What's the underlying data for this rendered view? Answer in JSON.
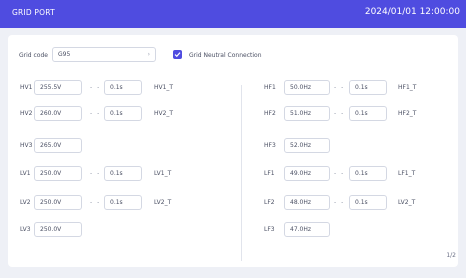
{
  "header": {
    "title": "GRID PORT",
    "datetime": "2024/01/01 12:00:00"
  },
  "grid_code": {
    "label": "Grid code",
    "value": "G95"
  },
  "neutral": {
    "label": "Grid Neutral Connection",
    "checked": true
  },
  "dash": "- -",
  "left_rows": [
    {
      "label": "HV1",
      "value": "255.5V",
      "time": "0.1s",
      "tag": "HV1_T"
    },
    {
      "label": "HV2",
      "value": "260.0V",
      "time": "0.1s",
      "tag": "HV2_T"
    },
    {
      "label": "HV3",
      "value": "265.0V"
    },
    {
      "label": "LV1",
      "value": "250.0V",
      "time": "0.1s",
      "tag": "LV1_T"
    },
    {
      "label": "LV2",
      "value": "250.0V",
      "time": "0.1s",
      "tag": "LV2_T"
    },
    {
      "label": "LV3",
      "value": "250.0V"
    }
  ],
  "right_rows": [
    {
      "label": "HF1",
      "value": "50.0Hz",
      "time": "0.1s",
      "tag": "HF1_T"
    },
    {
      "label": "HF2",
      "value": "51.0Hz",
      "time": "0.1s",
      "tag": "HF2_T"
    },
    {
      "label": "HF3",
      "value": "52.0Hz"
    },
    {
      "label": "LF1",
      "value": "49.0Hz",
      "time": "0.1s",
      "tag": "LF1_T"
    },
    {
      "label": "LF2",
      "value": "48.0Hz",
      "time": "0.1s",
      "tag": "LV2_T"
    },
    {
      "label": "LF3",
      "value": "47.0Hz"
    }
  ],
  "page_indicator": "1/2",
  "colors": {
    "accent": "#4f4ce0",
    "background": "#eef0f6",
    "panel": "#ffffff"
  }
}
